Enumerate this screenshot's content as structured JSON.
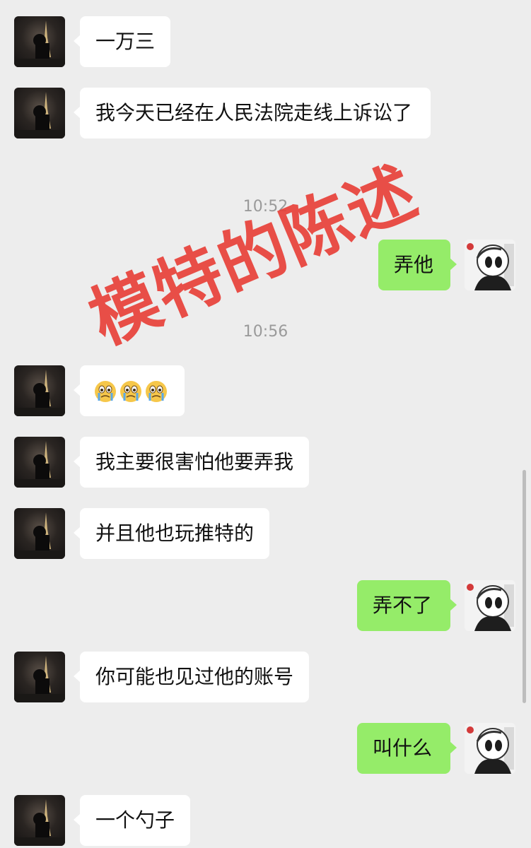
{
  "messages": [
    {
      "side": "left",
      "text": "一万三"
    },
    {
      "side": "left",
      "text": "我今天已经在人民法院走线上诉讼了"
    },
    {
      "time": "10:52"
    },
    {
      "side": "right",
      "text": "弄他"
    },
    {
      "time": "10:56"
    },
    {
      "side": "left",
      "emoji": [
        "cry-face-emoji",
        "cry-face-emoji",
        "cry-face-emoji"
      ]
    },
    {
      "side": "left",
      "text": "我主要很害怕他要弄我"
    },
    {
      "side": "left",
      "text": "并且他也玩推特的"
    },
    {
      "side": "right",
      "text": "弄不了"
    },
    {
      "side": "left",
      "text": "你可能也见过他的账号"
    },
    {
      "side": "right",
      "text": "叫什么"
    },
    {
      "side": "left",
      "text": "一个勺子"
    }
  ],
  "watermark": "模特的陈述",
  "colors": {
    "background": "#ededed",
    "incoming_bubble": "#ffffff",
    "outgoing_bubble": "#95ec69",
    "watermark": "#e8413a",
    "timestamp": "#9a9a9a"
  }
}
